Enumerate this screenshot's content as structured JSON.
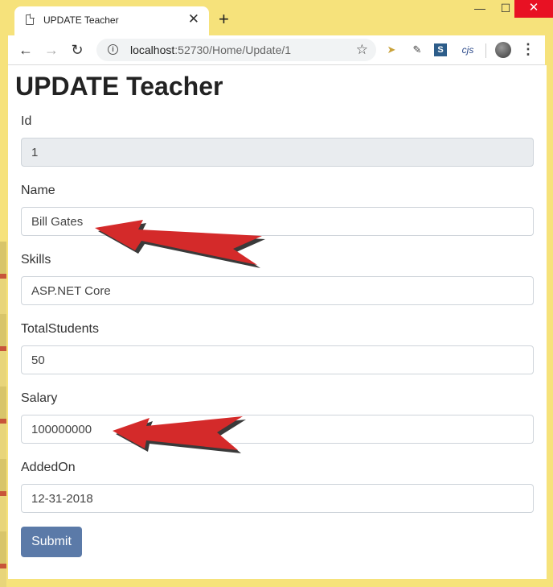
{
  "browser": {
    "tab_title": "UPDATE Teacher",
    "tab_close": "✕",
    "new_tab": "+",
    "url_host": "localhost",
    "url_path": ":52730/Home/Update/1",
    "ext_label": "cjs"
  },
  "page": {
    "heading": "UPDATE Teacher",
    "fields": [
      {
        "label": "Id",
        "value": "1",
        "readonly": true
      },
      {
        "label": "Name",
        "value": "Bill Gates"
      },
      {
        "label": "Skills",
        "value": "ASP.NET Core"
      },
      {
        "label": "TotalStudents",
        "value": "50"
      },
      {
        "label": "Salary",
        "value": "100000000"
      },
      {
        "label": "AddedOn",
        "value": "12-31-2018"
      }
    ],
    "submit_label": "Submit"
  },
  "colors": {
    "window_frame": "#f6e27b",
    "submit_button": "#5b7aa8",
    "arrow": "#d42a2a"
  },
  "icons": [
    "page-icon",
    "close-icon",
    "plus-icon",
    "back-icon",
    "forward-icon",
    "reload-icon",
    "info-icon",
    "star-icon",
    "menu-icon",
    "arrow-annotation-icon"
  ]
}
